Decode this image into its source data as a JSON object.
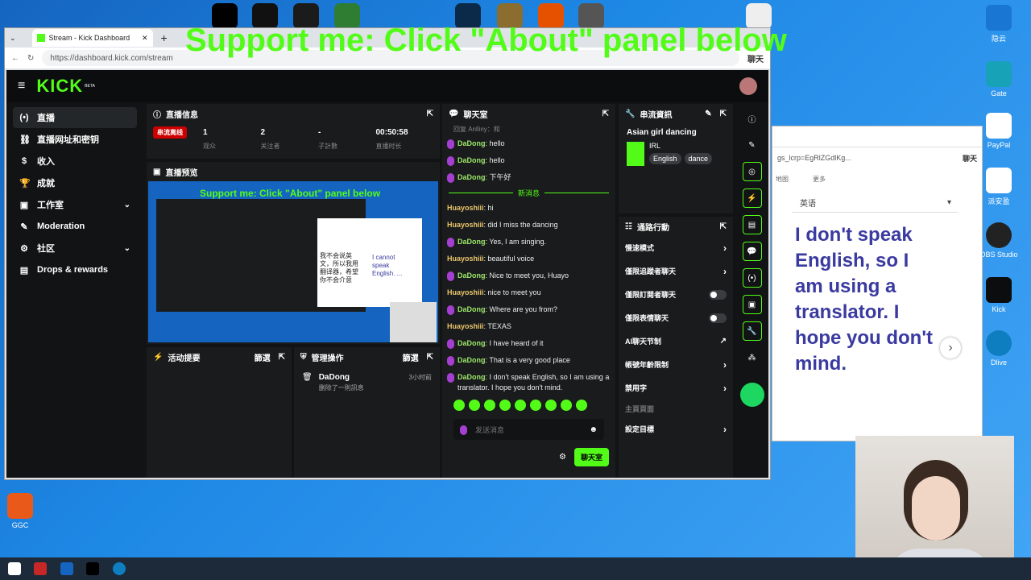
{
  "overlay_text": "Support me: Click \"About\" panel below",
  "browser": {
    "tab_title": "Stream - Kick Dashboard",
    "url": "https://dashboard.kick.com/stream",
    "chat_button": "聊天"
  },
  "desktop_icons": [
    {
      "name": "隐云"
    },
    {
      "name": "Gate"
    },
    {
      "name": "PayPal"
    },
    {
      "name": "派安盈"
    },
    {
      "name": "OBS Studio"
    },
    {
      "name": "Kick"
    },
    {
      "name": "Dlive"
    },
    {
      "name": "GGC"
    }
  ],
  "kick": {
    "logo": "KICK",
    "logo_badge": "BETA",
    "sidebar": [
      {
        "icon": "(•)",
        "label": "直播",
        "active": true
      },
      {
        "icon": "⛓",
        "label": "直播网址和密钥"
      },
      {
        "icon": "$",
        "label": "收入"
      },
      {
        "icon": "🏆",
        "label": "成就"
      },
      {
        "icon": "▣",
        "label": "工作室",
        "chevron": true
      },
      {
        "icon": "✎",
        "label": "Moderation"
      },
      {
        "icon": "⚙",
        "label": "社区",
        "chevron": true
      },
      {
        "icon": "▤",
        "label": "Drops & rewards"
      }
    ],
    "stream_info": {
      "title": "直播信息",
      "live_badge": "串流离线",
      "stats": [
        {
          "value": "1",
          "label": "观众"
        },
        {
          "value": "2",
          "label": "关注者"
        },
        {
          "value": "-",
          "label": "子計數"
        },
        {
          "value": "00:50:58",
          "label": "直播时长"
        }
      ]
    },
    "preview": {
      "title": "直播预览",
      "overlay_text": "Support me: Click \"About\" panel below",
      "snippet": "我不会说英文，所以我用翻译器，希望你不会介意",
      "snippet_en": "I cannot speak English. ..."
    },
    "activity": {
      "title": "活动提要",
      "filter": "篩選"
    },
    "mod": {
      "title": "管理操作",
      "filter": "篩選",
      "user": "DaDong",
      "action": "删除了一則訊息",
      "time": "3小时前"
    },
    "chat": {
      "title": "聊天室",
      "reply_line": "回复 Anlliny：和",
      "messages_before": [
        {
          "user": "DaDong",
          "text": "hello",
          "mic": true
        },
        {
          "user": "DaDong",
          "text": "hello",
          "mic": true
        },
        {
          "user": "DaDong",
          "text": "下午好",
          "mic": true
        }
      ],
      "new_label": "新消息",
      "messages": [
        {
          "user": "Huayoshiii",
          "text": "hi",
          "mic": false
        },
        {
          "user": "Huayoshiii",
          "text": "did I miss the dancing",
          "mic": false
        },
        {
          "user": "DaDong",
          "text": "Yes, I am singing.",
          "mic": true
        },
        {
          "user": "Huayoshiii",
          "text": "beautiful voice",
          "mic": false
        },
        {
          "user": "DaDong",
          "text": "Nice to meet you, Huayo",
          "mic": true
        },
        {
          "user": "Huayoshiii",
          "text": "nice to meet you",
          "mic": false
        },
        {
          "user": "DaDong",
          "text": "Where are you from?",
          "mic": true
        },
        {
          "user": "Huayoshiii",
          "text": "TEXAS",
          "mic": false
        },
        {
          "user": "DaDong",
          "text": "I have heard of it",
          "mic": true
        },
        {
          "user": "DaDong",
          "text": "That is a very good place",
          "mic": true
        },
        {
          "user": "DaDong",
          "text": "I don't speak English, so I am using a translator. I hope you don't mind.",
          "mic": true
        }
      ],
      "input_placeholder": "发送消息",
      "send_label": "聊天室"
    },
    "stream_details": {
      "title": "串流資訊",
      "stream_title": "Asian girl dancing",
      "category": "IRL",
      "tags": [
        "English",
        "dance"
      ]
    },
    "quick_actions": {
      "title": "通路行動",
      "items": [
        {
          "label": "慢速模式",
          "type": "chevron"
        },
        {
          "label": "僅限追蹤者聊天",
          "type": "chevron"
        },
        {
          "label": "僅限訂閱者聊天",
          "type": "toggle"
        },
        {
          "label": "僅限表情聊天",
          "type": "toggle"
        },
        {
          "label": "AI聊天节制",
          "type": "external"
        },
        {
          "label": "帳號年齡限制",
          "type": "chevron"
        },
        {
          "label": "禁用字",
          "type": "chevron"
        },
        {
          "label": "主頁頁面",
          "type": "section"
        },
        {
          "label": "設定目標",
          "type": "chevron"
        }
      ]
    }
  },
  "translator": {
    "url_fragment": "gs_lcrp=EgRlZGdlKg...",
    "chat_button": "聊天",
    "map_link": "地图",
    "more": "更多",
    "language": "英语",
    "text": "I don't speak English, so I am using a translator. I hope you don't mind."
  }
}
